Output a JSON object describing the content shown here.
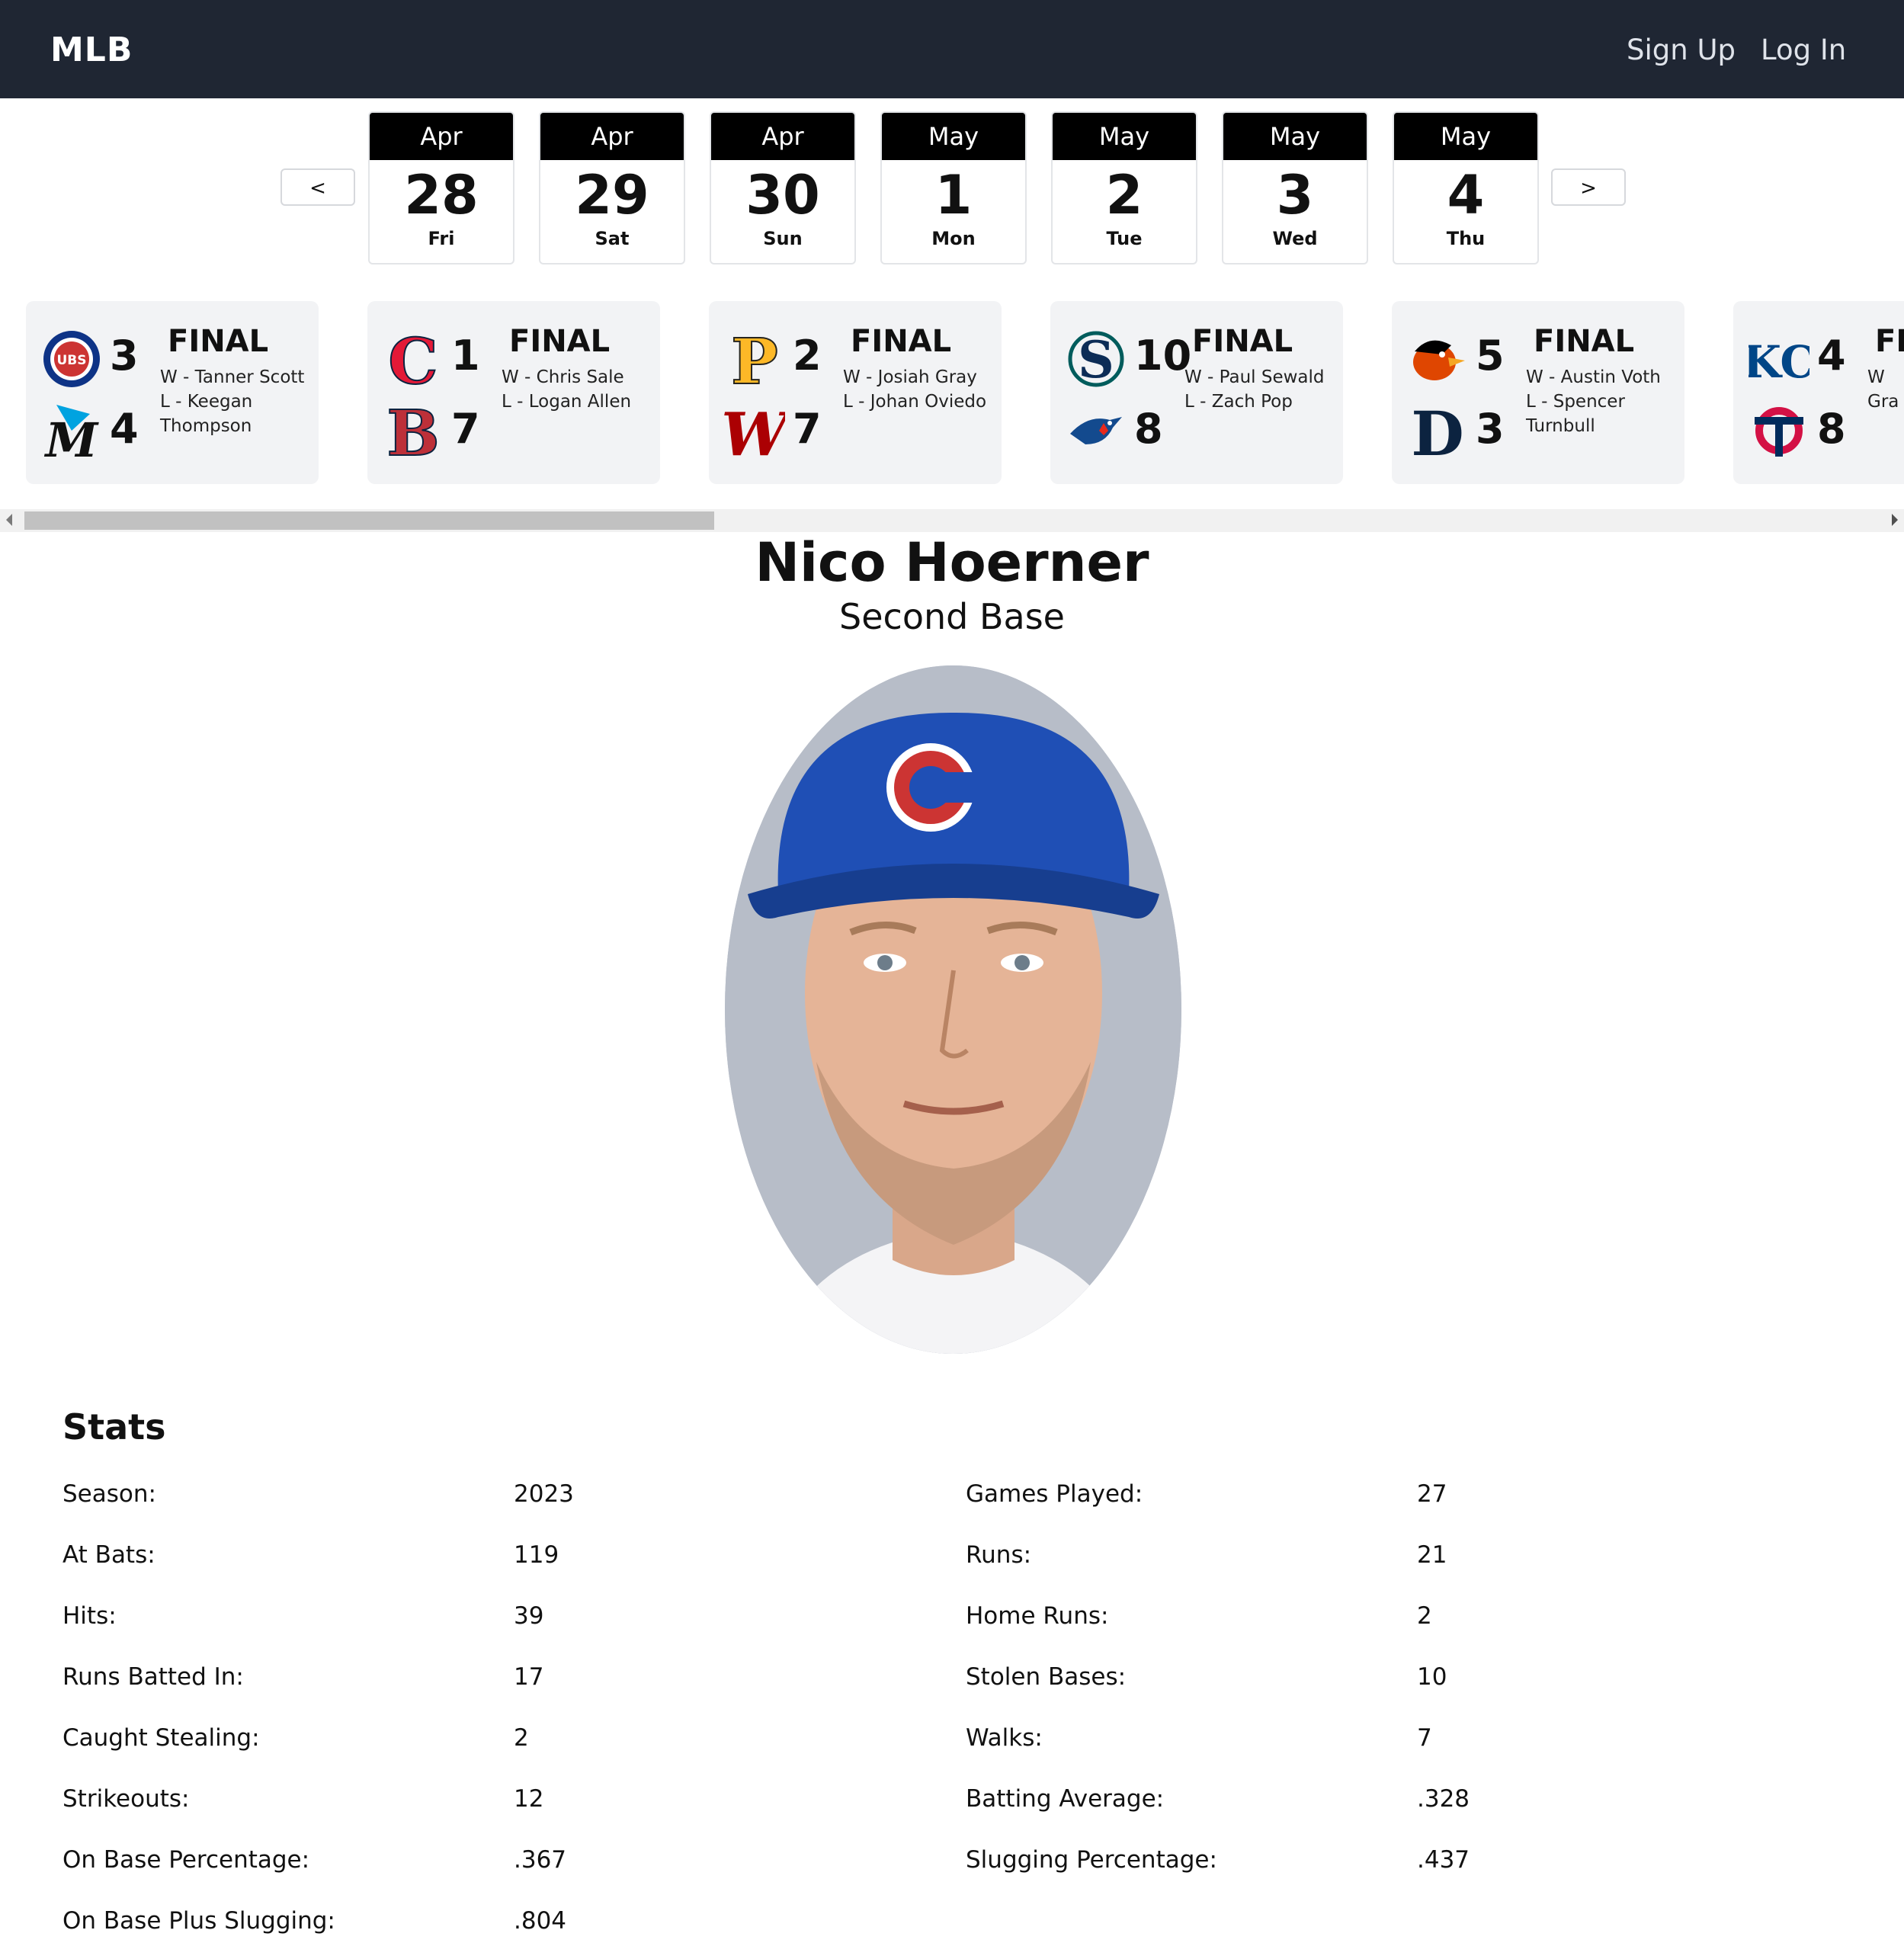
{
  "navbar": {
    "brand": "MLB",
    "signup": "Sign Up",
    "login": "Log In"
  },
  "dates": {
    "prev": "<",
    "next": ">",
    "items": [
      {
        "month": "Apr",
        "day": "28",
        "dow": "Fri"
      },
      {
        "month": "Apr",
        "day": "29",
        "dow": "Sat"
      },
      {
        "month": "Apr",
        "day": "30",
        "dow": "Sun"
      },
      {
        "month": "May",
        "day": "1",
        "dow": "Mon"
      },
      {
        "month": "May",
        "day": "2",
        "dow": "Tue"
      },
      {
        "month": "May",
        "day": "3",
        "dow": "Wed"
      },
      {
        "month": "May",
        "day": "4",
        "dow": "Thu"
      }
    ]
  },
  "games": [
    {
      "top_logo": "cubs-logo-icon",
      "bottom_logo": "marlins-logo-icon",
      "top_score": "3",
      "bottom_score": "4",
      "status": "FINAL",
      "winner": "W - Tanner Scott",
      "loser": "L - Keegan Thompson"
    },
    {
      "top_logo": "guardians-logo-icon",
      "bottom_logo": "red-sox-logo-icon",
      "top_score": "1",
      "bottom_score": "7",
      "status": "FINAL",
      "winner": "W - Chris Sale",
      "loser": "L - Logan Allen"
    },
    {
      "top_logo": "pirates-logo-icon",
      "bottom_logo": "nationals-logo-icon",
      "top_score": "2",
      "bottom_score": "7",
      "status": "FINAL",
      "winner": "W - Josiah Gray",
      "loser": "L - Johan Oviedo"
    },
    {
      "top_logo": "mariners-logo-icon",
      "bottom_logo": "blue-jays-logo-icon",
      "top_score": "10",
      "bottom_score": "8",
      "status": "FINAL",
      "winner": "W - Paul Sewald",
      "loser": "L - Zach Pop"
    },
    {
      "top_logo": "orioles-logo-icon",
      "bottom_logo": "tigers-logo-icon",
      "top_score": "5",
      "bottom_score": "3",
      "status": "FINAL",
      "winner": "W - Austin Voth",
      "loser": "L - Spencer Turnbull"
    },
    {
      "top_logo": "royals-logo-icon",
      "bottom_logo": "twins-logo-icon",
      "top_score": "4",
      "bottom_score": "8",
      "status": "FI",
      "winner": "W",
      "loser": "Gra L - Sin"
    }
  ],
  "player": {
    "name": "Nico Hoerner",
    "position": "Second Base",
    "photo_icon": "player-headshot"
  },
  "stats": {
    "title": "Stats",
    "items": [
      {
        "label": "Season:",
        "value": "2023"
      },
      {
        "label": "Games Played:",
        "value": "27"
      },
      {
        "label": "At Bats:",
        "value": "119"
      },
      {
        "label": "Runs:",
        "value": "21"
      },
      {
        "label": "Hits:",
        "value": "39"
      },
      {
        "label": "Home Runs:",
        "value": "2"
      },
      {
        "label": "Runs Batted In:",
        "value": "17"
      },
      {
        "label": "Stolen Bases:",
        "value": "10"
      },
      {
        "label": "Caught Stealing:",
        "value": "2"
      },
      {
        "label": "Walks:",
        "value": "7"
      },
      {
        "label": "Strikeouts:",
        "value": "12"
      },
      {
        "label": "Batting Average:",
        "value": ".328"
      },
      {
        "label": "On Base Percentage:",
        "value": ".367"
      },
      {
        "label": "Slugging Percentage:",
        "value": ".437"
      },
      {
        "label": "On Base Plus Slugging:",
        "value": ".804"
      }
    ]
  },
  "colors": {
    "navbar": "#1f2633",
    "card_bg": "#f2f3f5",
    "cubs_blue": "#0e3386",
    "cubs_red": "#cc3433"
  }
}
